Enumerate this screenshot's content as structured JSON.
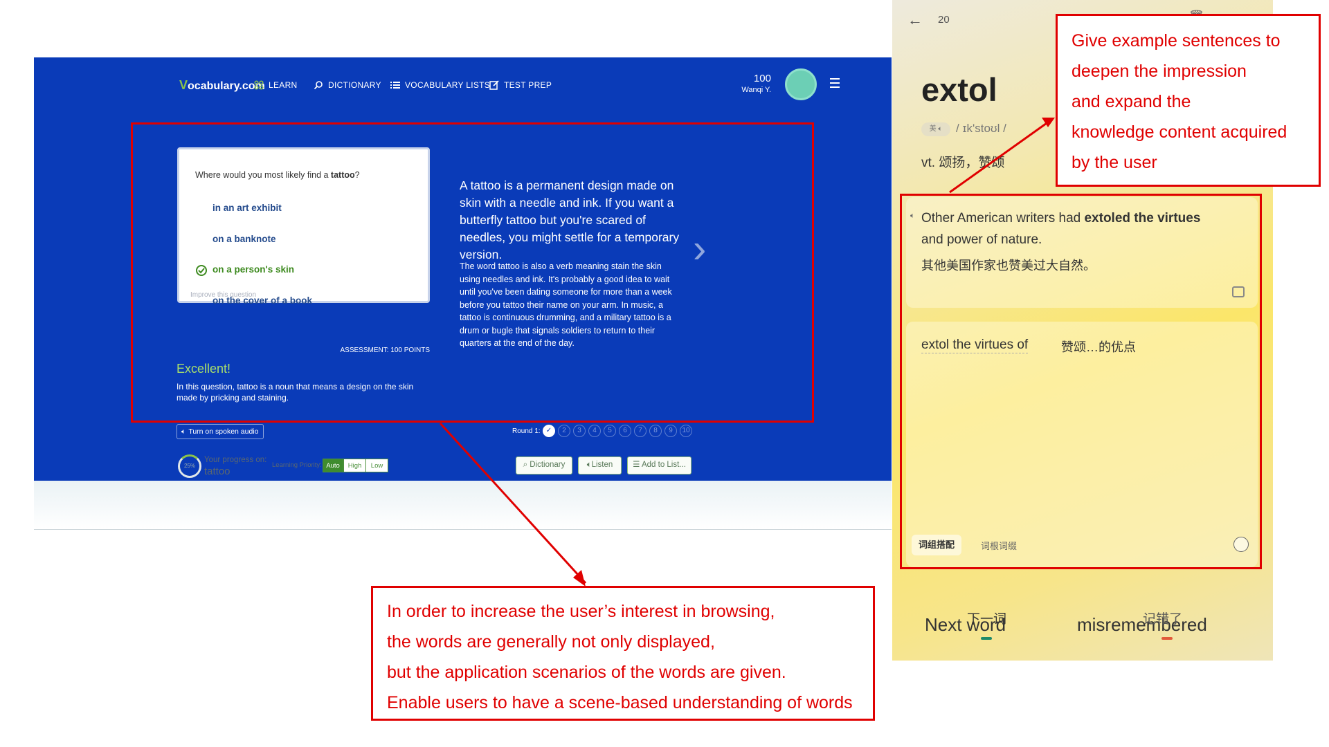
{
  "left_app": {
    "logo": "Vocabulary.com",
    "logo_v": "V",
    "logo_rest": "ocabulary.com",
    "nav": [
      "LEARN",
      "DICTIONARY",
      "VOCABULARY LISTS",
      "TEST PREP"
    ],
    "points": "100",
    "user": "Wanqi Y.",
    "question_prefix": "Where would you most likely find a ",
    "question_word": "tattoo",
    "question_suffix": "?",
    "options": [
      "in an art exhibit",
      "on a banknote",
      "on a person's skin",
      "on the cover of a book"
    ],
    "correct_index": 2,
    "improve": "Improve this question",
    "assessment": "ASSESSMENT: 100 POINTS",
    "excellent": "Excellent!",
    "explanation": "In this question, tattoo is a noun that means a design on the skin made by pricking and staining.",
    "definition_short": "A tattoo is a permanent design made on skin with a needle and ink. If you want a butterfly tattoo but you're scared of needles, you might settle for a temporary version.",
    "definition_long": "The word tattoo is also a verb meaning stain the skin using needles and ink. It's probably a good idea to wait until you've been dating someone for more than a week before you tattoo their name on your arm. In music, a tattoo is continuous drumming, and a military tattoo is a drum or bugle that signals soldiers to return to their quarters at the end of the day.",
    "audio_button": "Turn on spoken audio",
    "round_label": "Round 1:",
    "round_dots": [
      "2",
      "3",
      "4",
      "5",
      "6",
      "7",
      "8",
      "9",
      "10"
    ],
    "progress_percent": "25%",
    "progress_label": "Your progress on:",
    "progress_word": "tattoo",
    "priority_label": "Learning Priority:",
    "priority_options": [
      "Auto",
      "High",
      "Low"
    ],
    "tools": [
      "Dictionary",
      "Listen",
      "Add to List..."
    ]
  },
  "phone": {
    "count": "20",
    "word": "extol",
    "region": "美",
    "phonetic": "/ ɪk'stoʊl /",
    "meaning": "vt. 颂扬，赞颂",
    "example_en_pre": "Other American writers had ",
    "example_en_bold1": "extoled the",
    "example_en_bold2": "virtues",
    "example_en_post": " and power of nature.",
    "example_zh": "其他美国作家也赞美过大自然。",
    "phrase_en": "extol the virtues of",
    "phrase_zh": "赞颂…的优点",
    "tabs": [
      "词组搭配",
      "词根词缀"
    ],
    "next_zh": "下一词",
    "next_en": "Next word",
    "miss_zh": "记错了",
    "miss_en": "misremembered"
  },
  "annotations": {
    "right": [
      "Give example sentences to",
      "deepen the  impression",
      "and expand the",
      "knowledge content acquired",
      "by the user"
    ],
    "bottom": [
      "In order to increase the user’s interest in browsing,",
      "the words are generally not only displayed,",
      "but the application scenarios of the words are given.",
      "Enable users to have a scene-based understanding of words"
    ]
  },
  "colors": {
    "annotation_red": "#e00000",
    "brand_blue": "#0a3bb8",
    "correct_green": "#3d8a1f"
  }
}
